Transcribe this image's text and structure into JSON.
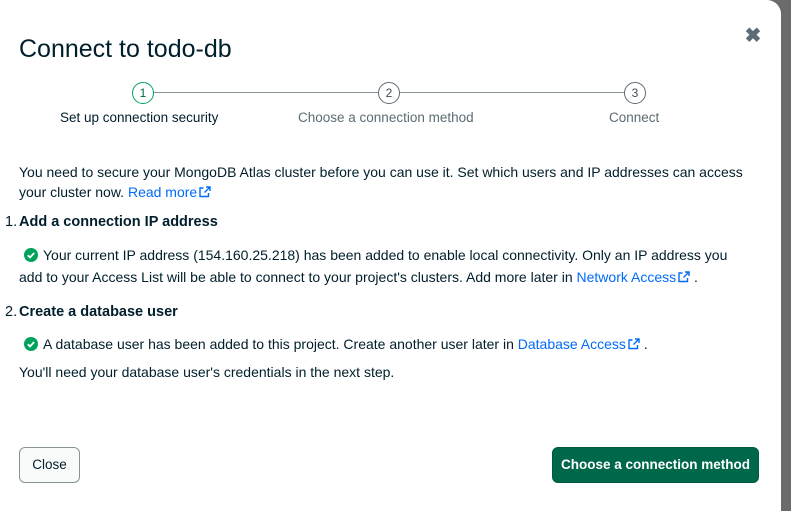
{
  "dialog": {
    "title": "Connect to todo-db",
    "close_symbol": "✖"
  },
  "stepper": {
    "steps": [
      {
        "number": "1",
        "label": "Set up connection security",
        "active": true
      },
      {
        "number": "2",
        "label": "Choose a connection method",
        "active": false
      },
      {
        "number": "3",
        "label": "Connect",
        "active": false
      }
    ]
  },
  "intro": {
    "text": "You need to secure your MongoDB Atlas cluster before you can use it. Set which users and IP addresses can access your cluster now.",
    "link": "Read more"
  },
  "section1": {
    "number": "1.",
    "heading": "Add a connection IP address",
    "line1": "Your current IP address (154.160.25.218) has been added to enable local connectivity. Only an IP address you",
    "line2": "add to your Access List will be able to connect to your project's clusters. Add more later in",
    "link": "Network Access",
    "suffix": "."
  },
  "section2": {
    "number": "2.",
    "heading": "Create a database user",
    "line1": "A database user has been added to this project. Create another user later in",
    "link": "Database Access",
    "suffix": ".",
    "note": "You'll need your database user's credentials in the next step."
  },
  "footer": {
    "close_label": "Close",
    "primary_label": "Choose a connection method"
  },
  "icons": {
    "check": "check-circle-icon",
    "external": "external-link-icon",
    "close": "close-icon"
  },
  "colors": {
    "primary": "#00684a",
    "link": "#016bf8",
    "success": "#00a35c"
  }
}
